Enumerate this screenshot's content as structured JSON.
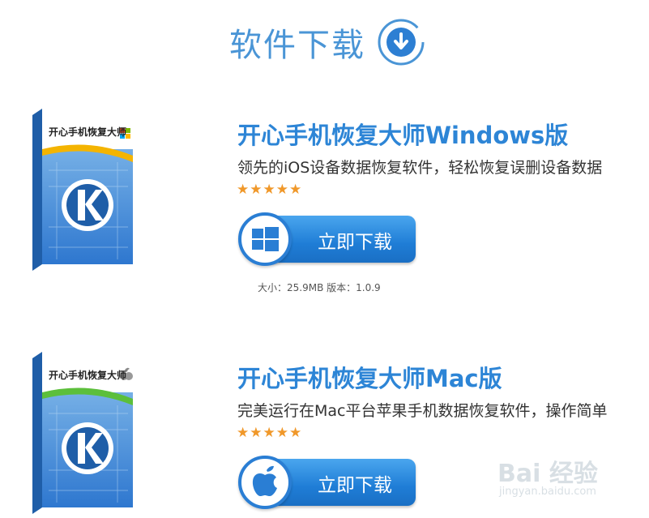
{
  "header": {
    "title": "软件下载",
    "icon": "download-circle-icon"
  },
  "products": [
    {
      "box_title": "开心手机恢复大师",
      "box_logo_letter": "K",
      "os_badge_icon": "windows-flag-icon",
      "title": "开心手机恢复大师Windows版",
      "description": "领先的iOS设备数据恢复软件，轻松恢复误删设备数据",
      "rating": 5,
      "stars": "★★★★★",
      "download_label": "立即下载",
      "platform_icon": "windows-icon",
      "meta": "大小：25.9MB 版本：1.0.9"
    },
    {
      "box_title": "开心手机恢复大师",
      "box_logo_letter": "K",
      "os_badge_icon": "apple-icon",
      "title": "开心手机恢复大师Mac版",
      "description": "完美运行在Mac平台苹果手机数据恢复软件，操作简单",
      "rating": 5,
      "stars": "★★★★★",
      "download_label": "立即下载",
      "platform_icon": "apple-icon"
    }
  ],
  "watermark": {
    "main": "Bai 经验",
    "sub": "jingyan.baidu.com"
  },
  "colors": {
    "accent": "#2d85d6",
    "header_text": "#4a95d6",
    "star": "#f0982a",
    "button": "#1f7dd6"
  }
}
